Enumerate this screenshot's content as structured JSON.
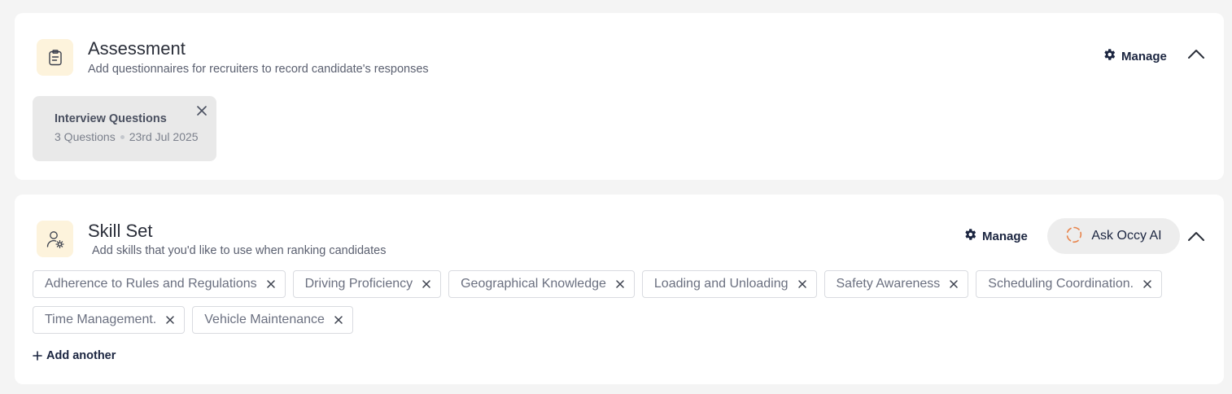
{
  "assessment": {
    "title": "Assessment",
    "subtitle": "Add questionnaires for recruiters to record candidate's responses",
    "manage_label": "Manage",
    "questionnaire": {
      "title": "Interview Questions",
      "count": "3 Questions",
      "date": "23rd Jul 2025"
    }
  },
  "skills": {
    "title": "Skill Set",
    "subtitle": "Add skills that you'd like to use when ranking candidates",
    "manage_label": "Manage",
    "ask_ai_label": "Ask Occy AI",
    "items": [
      "Adherence to Rules and Regulations",
      "Driving Proficiency",
      "Geographical Knowledge",
      "Loading and Unloading",
      "Safety Awareness",
      "Scheduling Coordination.",
      "Time Management.",
      "Vehicle Maintenance"
    ],
    "add_label": "Add another"
  },
  "colors": {
    "icon_bg": "#fdf3dc",
    "accent_dark": "#1b2540",
    "occy_orange": "#e8834a"
  }
}
